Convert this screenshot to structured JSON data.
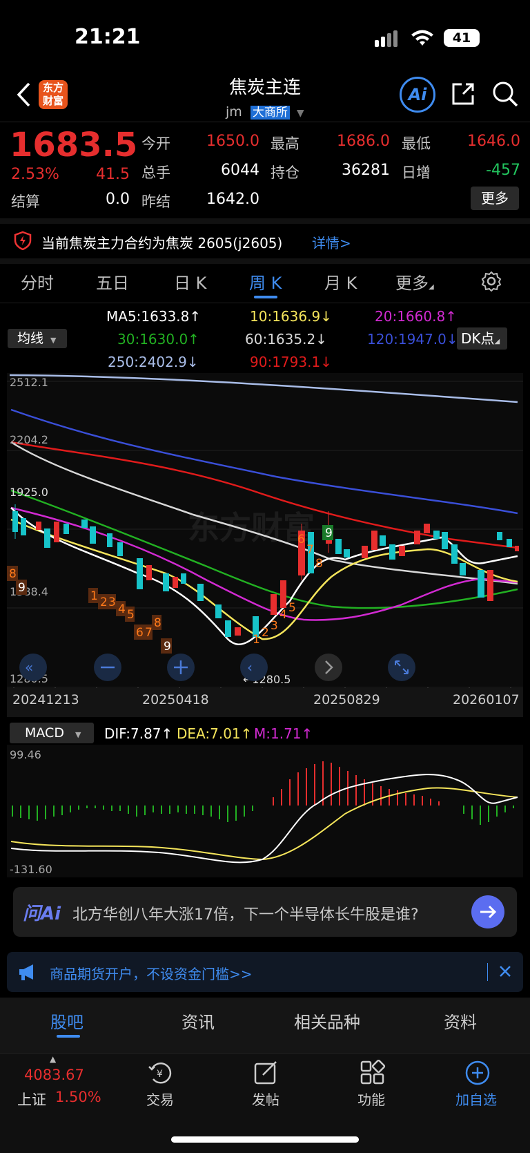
{
  "status_bar": {
    "time": "21:21",
    "battery": "41"
  },
  "header": {
    "title": "焦炭主连",
    "code": "jm",
    "exchange": "大商所",
    "logo_text": "东方财富",
    "ai_label": "Ai"
  },
  "quote": {
    "price": "1683.5",
    "change_pct": "2.53%",
    "change": "41.5",
    "open_label": "今开",
    "open": "1650.0",
    "high_label": "最高",
    "high": "1686.0",
    "low_label": "最低",
    "low": "1646.0",
    "volume_label": "总手",
    "volume": "6044",
    "oi_label": "持仓",
    "oi": "36281",
    "daily_inc_label": "日增",
    "daily_inc": "-457",
    "settle_label": "结算",
    "settle": "0.0",
    "prev_settle_label": "昨结",
    "prev_settle": "1642.0",
    "more_label": "更多"
  },
  "notice": {
    "text": "当前焦炭主力合约为焦炭 2605(j2605)",
    "link": "详情>"
  },
  "tabs": {
    "t1": "分时",
    "t2": "五日",
    "t3": "日 K",
    "t4": "周 K",
    "t5": "月 K",
    "t6": "更多",
    "active": "周 K"
  },
  "ma": {
    "selector": "均线",
    "ma5": "MA5:1633.8↑",
    "ma10": "10:1636.9↓",
    "ma20": "20:1660.8↑",
    "ma30": "30:1630.0↑",
    "ma60": "60:1635.2↓",
    "ma120": "120:1947.0↓",
    "ma250": "250:2402.9↓",
    "ma90": "90:1793.1↓",
    "dk_label": "DK点"
  },
  "kline": {
    "y_labels": {
      "top": "2512.1",
      "l2": "2204.2",
      "l3": "1925.0",
      "l4": "1588.4",
      "bottom": "1280.5"
    },
    "min_marker": "←1280.5",
    "x_labels": {
      "d1": "20241213",
      "d2": "20250418",
      "d3": "20250829",
      "d4": "20260107"
    },
    "td_numbers_down": [
      "8",
      "9",
      "1",
      "2",
      "3",
      "4",
      "5",
      "6",
      "7",
      "8",
      "9"
    ],
    "td_numbers_up": [
      "1",
      "2",
      "3",
      "4",
      "5",
      "6",
      "7",
      "8",
      "9"
    ],
    "colors": {
      "up": "#e62e2e",
      "down": "#17c3c9",
      "ma5": "#ffffff",
      "ma10": "#f5e55b",
      "ma20": "#d22ad2",
      "ma30": "#22b022",
      "ma60": "#d8d8d8",
      "ma90": "#e01b1b",
      "ma120": "#3a4fd8",
      "ma250": "#a9bde8"
    }
  },
  "macd": {
    "selector": "MACD",
    "dif": "DIF:7.87↑",
    "dea": "DEA:7.01↑",
    "m": "M:1.71↑",
    "y_top": "99.46",
    "y_bottom": "-131.60"
  },
  "ask_ai": {
    "logo": "问Ai",
    "prompt": "北方华创八年大涨17倍，下一个半导体长牛股是谁?"
  },
  "ad_banner": {
    "text": "商品期货开户，不设资金门槛>>"
  },
  "bottom_tabs": {
    "b1": "股吧",
    "b2": "资讯",
    "b3": "相关品种",
    "b4": "资料",
    "active": "股吧"
  },
  "bottom_nav": {
    "index_value": "4083.67",
    "index_name": "上证",
    "index_pct": "1.50%",
    "trade": "交易",
    "post": "发帖",
    "func": "功能",
    "add": "加自选"
  }
}
